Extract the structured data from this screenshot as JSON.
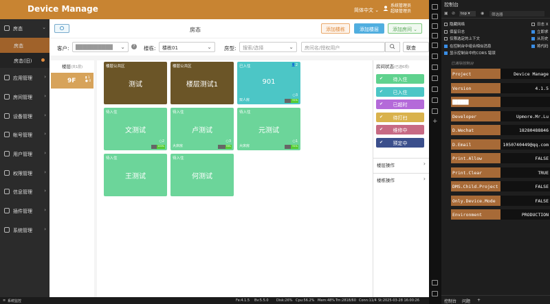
{
  "header": {
    "title": "Device Manage",
    "language": "简体中文 ⌄",
    "user_line1": "系统管理员",
    "user_line2": "超级管理员"
  },
  "sidebar": {
    "items": [
      {
        "label": "房态",
        "expanded": true
      },
      {
        "label": "应用管理"
      },
      {
        "label": "房间管理"
      },
      {
        "label": "设备管理"
      },
      {
        "label": "帐号管理"
      },
      {
        "label": "用户管理"
      },
      {
        "label": "权限管理"
      },
      {
        "label": "信息管理"
      },
      {
        "label": "插件管理"
      },
      {
        "label": "系统管理"
      }
    ],
    "sub_items": [
      {
        "label": "房态",
        "active": true
      },
      {
        "label": "房态(旧)"
      }
    ]
  },
  "toolbar": {
    "title": "房态",
    "add_floor": "添加楼栋",
    "add_level": "添加楼层",
    "add_room": "添加房间 ⌄"
  },
  "filter": {
    "customer_label": "客户:",
    "customer_value": "██████████",
    "building_label": "楼栋:",
    "building_value": "楼栋01",
    "room_type_label": "房型:",
    "room_type_placeholder": "搜索/选择",
    "search_placeholder": "房间名/授权用户",
    "link_label": "联查"
  },
  "floors": {
    "header": "楼层",
    "header_count": "(共1层)",
    "items": [
      {
        "name": "9F",
        "count1": "1",
        "count2": "0"
      }
    ]
  },
  "rooms": [
    {
      "status": "楼层公共区",
      "name": "测试",
      "type": "",
      "count": "",
      "battery": "",
      "color": "#6b5527"
    },
    {
      "status": "楼层公共区",
      "name": "楼层测试1",
      "type": "",
      "count": "",
      "battery": "",
      "color": "#6b5527"
    },
    {
      "status": "已入住",
      "name": "901",
      "type": "双人房",
      "count": "3",
      "battery": "91%",
      "color": "#4cc6c6",
      "corner": "2"
    },
    {
      "status": "待入住",
      "name": "文测试",
      "type": "",
      "count": "2",
      "battery": "100%",
      "color": "#6cd59a"
    },
    {
      "status": "待入住",
      "name": "卢测试",
      "type": "大床房",
      "count": "3",
      "battery": "78%",
      "color": "#6cd59a"
    },
    {
      "status": "待入住",
      "name": "元测试",
      "type": "大床房",
      "count": "1",
      "battery": "91%",
      "color": "#6cd59a"
    },
    {
      "status": "待入住",
      "name": "王测试",
      "type": "",
      "count": "",
      "battery": "",
      "color": "#6cd59a"
    },
    {
      "status": "待入住",
      "name": "何测试",
      "type": "",
      "count": "",
      "battery": "",
      "color": "#6cd59a"
    }
  ],
  "status_panel": {
    "header": "房间状态",
    "header_count": "(已选6项)",
    "buttons": [
      {
        "label": "待入住",
        "color": "#5fd28e"
      },
      {
        "label": "已入住",
        "color": "#4cc6c6"
      },
      {
        "label": "已超时",
        "color": "#b46ad9"
      },
      {
        "label": "待打扫",
        "color": "#d9b24c"
      },
      {
        "label": "维修中",
        "color": "#c76a84"
      },
      {
        "label": "预定中",
        "color": "#3b4f8c"
      }
    ],
    "sections": [
      {
        "label": "楼层操作"
      },
      {
        "label": "楼栋操作"
      }
    ]
  },
  "statusbar": {
    "left": "系统监控",
    "fe": "Fe:4.1.5",
    "be": "Bv:5.5.0",
    "disk": "Disk:26%",
    "cpu": "Cpu:56.2%",
    "mem": "Mem:48%",
    "trn": "Trn:2818/60",
    "conn": "Conn:11/4",
    "st": "St:2025-03-28 16:00:26"
  },
  "devtools": {
    "title": "控制台",
    "context": "top ▾",
    "filter_placeholder": "筛选器",
    "options": [
      {
        "label": "隐藏网络",
        "checked": false
      },
      {
        "label": "保留日志",
        "checked": false
      },
      {
        "label": "仅限选定的上下文",
        "checked": false
      },
      {
        "label": "在控制台中组合相似消息",
        "checked": true
      },
      {
        "label": "显示控制台中的CORS 错误",
        "checked": true
      }
    ],
    "options_right": [
      {
        "label": "日志 X",
        "checked": false
      },
      {
        "label": "立即求",
        "checked": true
      },
      {
        "label": "从历史",
        "checked": true
      },
      {
        "label": "将代码",
        "checked": true
      }
    ],
    "subtitle": "已清除控制台",
    "rows": [
      {
        "key": "Project",
        "value": "Device Manage"
      },
      {
        "key": "Version",
        "value": "4.1.5"
      },
      {
        "key": "██████",
        "value": ""
      },
      {
        "key": "Developer",
        "value": "Upmore.Mr.Lu"
      },
      {
        "key": "D.Wechat",
        "value": "18280488846"
      },
      {
        "key": "D.Email",
        "value": "1050740449@qq.com"
      },
      {
        "key": "Print.Allow",
        "value": "FALSE"
      },
      {
        "key": "Print.Clear",
        "value": "TRUE"
      },
      {
        "key": "DMS.Child.Project",
        "value": "FALSE"
      },
      {
        "key": "Only.Device.Mode",
        "value": "FALSE"
      },
      {
        "key": "Environment",
        "value": "PRODUCTION"
      }
    ],
    "bottom_tabs": [
      "控制台",
      "问题"
    ]
  }
}
